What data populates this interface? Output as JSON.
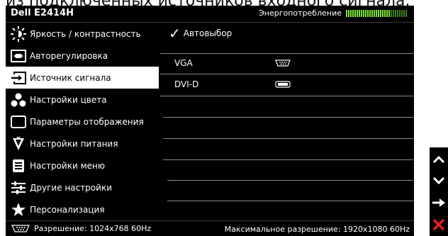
{
  "top_caption": "из подключенных источников входного сигнала.",
  "header": {
    "model": "Dell E2414H",
    "energy_label": "Энергопотребление",
    "energy_level": 0.72
  },
  "menu": {
    "items": [
      {
        "label": "Яркость / контрастность",
        "icon": "brightness-icon"
      },
      {
        "label": "Авторегулировка",
        "icon": "auto-adjust-icon"
      },
      {
        "label": "Источник сигнала",
        "icon": "input-source-icon"
      },
      {
        "label": "Настройки цвета",
        "icon": "color-settings-icon"
      },
      {
        "label": "Параметры отображения",
        "icon": "display-settings-icon"
      },
      {
        "label": "Настройки питания",
        "icon": "power-settings-icon"
      },
      {
        "label": "Настройки меню",
        "icon": "menu-settings-icon"
      },
      {
        "label": "Другие настройки",
        "icon": "other-settings-icon"
      },
      {
        "label": "Персонализация",
        "icon": "star-icon"
      }
    ],
    "selected_index": 2
  },
  "content": {
    "options": [
      {
        "label": "Автовыбор",
        "checked": true
      },
      {
        "label": "VGA",
        "icon": "vga-connector-icon"
      },
      {
        "label": "DVI-D",
        "icon": "dvi-connector-icon"
      }
    ]
  },
  "footer": {
    "resolution": "Разрешение: 1024x768 60Hz",
    "max_resolution": "Максимальное разрешение: 1920x1080 60Hz"
  },
  "colors": {
    "osd_background": "#000000",
    "selected_background": "#ffffff",
    "energy_bar": "#7ee33a",
    "exit_button": "#e0201b"
  }
}
